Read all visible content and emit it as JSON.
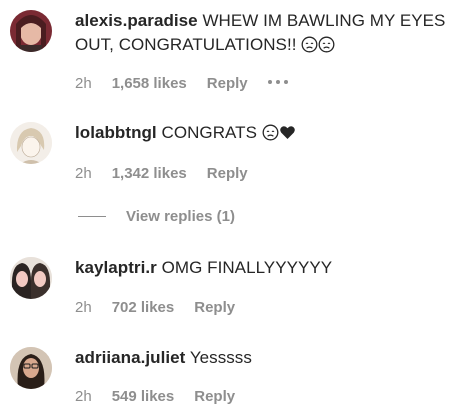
{
  "comments": [
    {
      "username": "alexis.paradise",
      "text": "WHEW IM BAWLING MY EYES OUT, CONGRATULATIONS!!",
      "emojis": [
        "sad-face",
        "sad-face"
      ],
      "time": "2h",
      "likes": "1,658 likes",
      "reply": "Reply",
      "has_more_options": true
    },
    {
      "username": "lolabbtngl",
      "text": "CONGRATS",
      "emojis": [
        "sad-face",
        "black-heart"
      ],
      "time": "2h",
      "likes": "1,342 likes",
      "reply": "Reply",
      "view_replies": "View replies (1)"
    },
    {
      "username": "kaylaptri.r",
      "text": "OMG FINALLYYYYYY",
      "time": "2h",
      "likes": "702 likes",
      "reply": "Reply"
    },
    {
      "username": "adriiana.juliet",
      "text": "Yesssss",
      "time": "2h",
      "likes": "549 likes",
      "reply": "Reply"
    }
  ],
  "colors": {
    "text": "#262626",
    "secondary": "#8e8e8e",
    "background": "#ffffff"
  }
}
